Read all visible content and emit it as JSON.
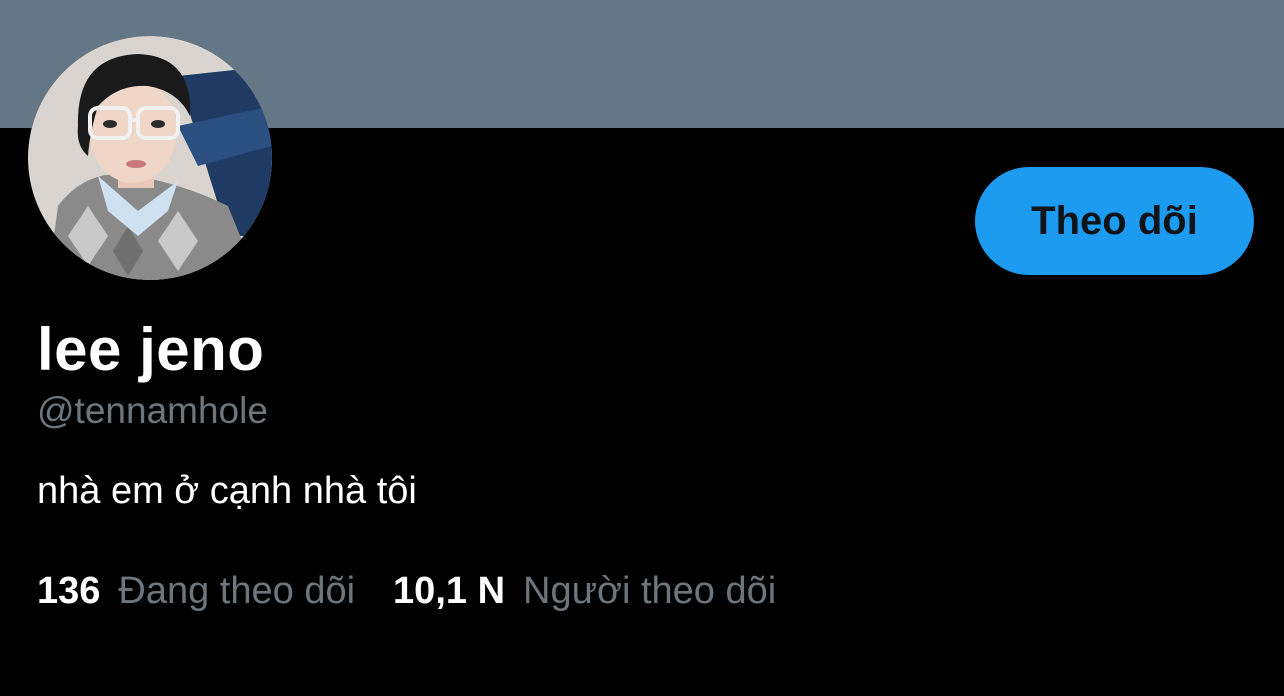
{
  "profile": {
    "display_name": "lee jeno",
    "handle": "@tennamhole",
    "bio": "nhà em ở cạnh nhà tôi"
  },
  "actions": {
    "follow_label": "Theo dõi"
  },
  "stats": {
    "following_count": "136",
    "following_label": "Đang theo dõi",
    "followers_count": "10,1 N",
    "followers_label": "Người theo dõi"
  },
  "colors": {
    "banner": "#657786",
    "accent": "#1d9bf0",
    "background": "#000000",
    "secondary_text": "#6e767d"
  }
}
